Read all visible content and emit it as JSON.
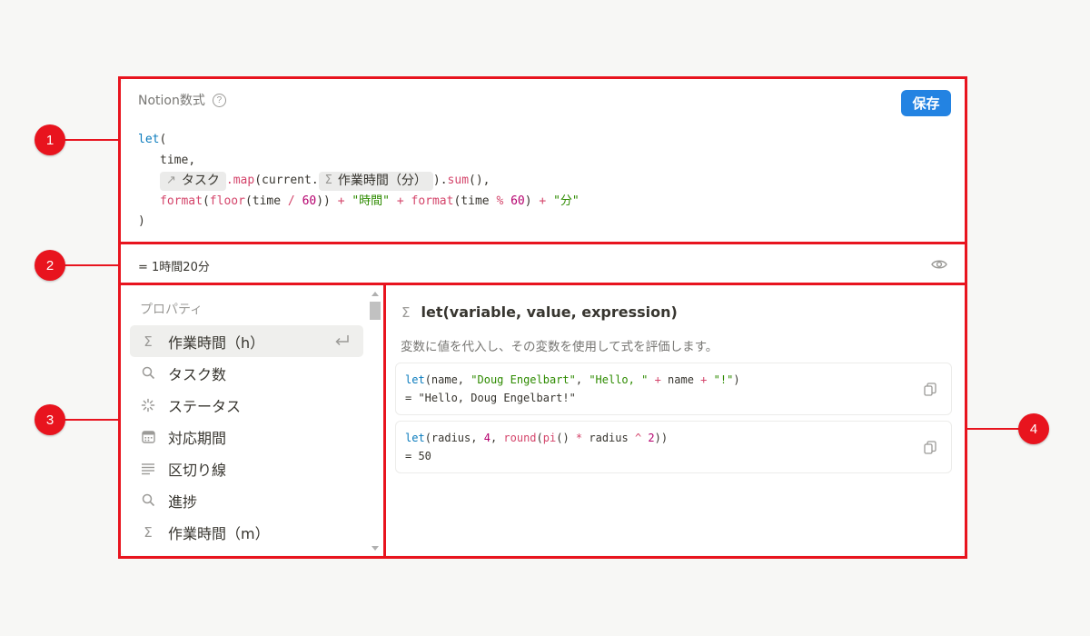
{
  "editor": {
    "title": "Notion数式",
    "help_icon": "question-circle-icon",
    "save_label": "保存",
    "code": {
      "let_kw": "let",
      "open_paren": "(",
      "var_name": "time",
      "comma": ",",
      "chip_tasks_icon": "↗",
      "chip_tasks_label": "タスク",
      "map_fn": ".map",
      "map_open": "(current.",
      "chip_hours_icon": "Σ",
      "chip_hours_label": "作業時間（分）",
      "map_close": ").",
      "sum_fn": "sum",
      "sum_tail": "(),",
      "format_fn": "format",
      "floor_fn": "floor",
      "time_var": "time",
      "slash": "/",
      "sixty": "60",
      "plus": "+",
      "str_hours": "\"時間\"",
      "percent": "%",
      "str_minutes": "\"分\"",
      "close_paren": ")"
    }
  },
  "result": {
    "text": "=  1時間20分",
    "eye_icon": "eye-icon"
  },
  "properties": {
    "header": "プロパティ",
    "items": [
      {
        "icon": "sigma-icon",
        "glyph": "Σ",
        "label": "作業時間（h）",
        "selected": true
      },
      {
        "icon": "search-icon",
        "glyph": "",
        "label": "タスク数"
      },
      {
        "icon": "loading-spinner-icon",
        "glyph": "",
        "label": "ステータス"
      },
      {
        "icon": "calendar-icon",
        "glyph": "",
        "label": "対応期間"
      },
      {
        "icon": "text-lines-icon",
        "glyph": "",
        "label": "区切り線"
      },
      {
        "icon": "search-icon",
        "glyph": "",
        "label": "進捗"
      },
      {
        "icon": "sigma-icon",
        "glyph": "Σ",
        "label": "作業時間（m）"
      }
    ]
  },
  "docs": {
    "title_icon": "Σ",
    "title": "let(variable, value, expression)",
    "description": "変数に値を代入し、その変数を使用して式を評価します。",
    "examples": [
      {
        "line1_parts": {
          "kw": "let",
          "p1": "(name, ",
          "s1": "\"Doug Engelbart\"",
          "p2": ", ",
          "s2": "\"Hello, \"",
          "op": " + ",
          "p3": "name",
          "op2": " + ",
          "s3": "\"!\"",
          "p4": ")"
        },
        "result": "= \"Hello, Doug Engelbart!\""
      },
      {
        "line1_parts": {
          "kw": "let",
          "p1": "(radius, ",
          "n1": "4",
          "p2": ", ",
          "fn1": "round",
          "p3": "(",
          "fn2": "pi",
          "p4": "() ",
          "op": "*",
          "p5": " radius ",
          "op2": "^",
          "p6": " ",
          "n2": "2",
          "p7": "))"
        },
        "result": "= 50"
      }
    ]
  },
  "callouts": [
    "1",
    "2",
    "3",
    "4"
  ],
  "colors": {
    "annotation_red": "#e8141e",
    "save_blue": "#2383e2",
    "keyword_blue": "#0a7bbd",
    "function_pink": "#d4456b",
    "string_green": "#2e8b00",
    "number_purple": "#b5006e"
  }
}
